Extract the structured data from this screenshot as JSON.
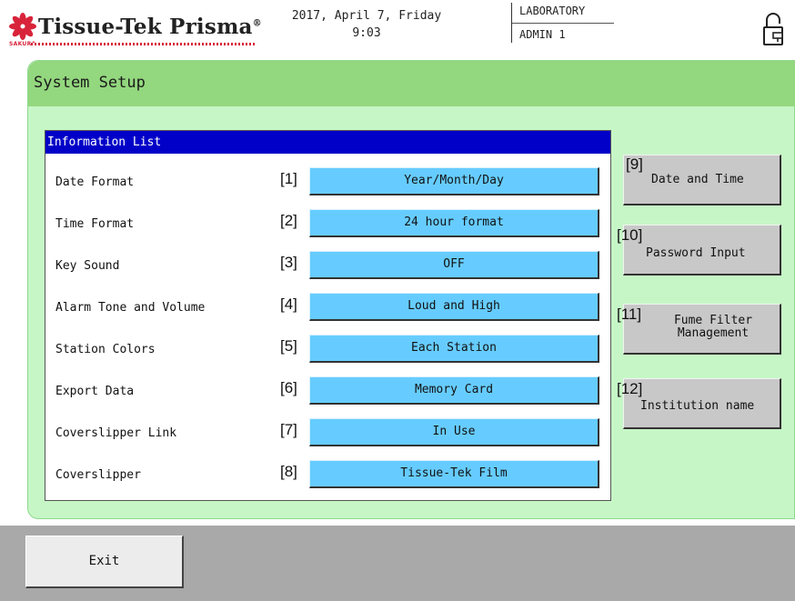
{
  "header": {
    "logo_text": "Tissue-Tek Prisma",
    "logo_reg": "®",
    "logo_brand": "SAKURA",
    "date": "2017, April 7, Friday",
    "time": "9:03",
    "area": "LABORATORY",
    "user": "ADMIN 1",
    "icons": {
      "logo": "sakura-flower-icon",
      "lock": "padlock-icon"
    },
    "colors": {
      "logo_red": "#d8243a"
    }
  },
  "panel": {
    "title": "System Setup",
    "colors": {
      "background": "#c6f6c6",
      "titlebar": "#93d77e"
    }
  },
  "info_list": {
    "title": "Information List",
    "colors": {
      "header": "#0000c8",
      "button": "#66ccff"
    },
    "rows": [
      {
        "label": "Date Format",
        "index": "[1]",
        "value": "Year/Month/Day"
      },
      {
        "label": "Time Format",
        "index": "[2]",
        "value": "24 hour format"
      },
      {
        "label": "Key Sound",
        "index": "[3]",
        "value": "OFF"
      },
      {
        "label": "Alarm Tone and Volume",
        "index": "[4]",
        "value": "Loud and High"
      },
      {
        "label": "Station Colors",
        "index": "[5]",
        "value": "Each Station"
      },
      {
        "label": "Export Data",
        "index": "[6]",
        "value": "Memory Card"
      },
      {
        "label": "Coverslipper Link",
        "index": "[7]",
        "value": "In Use"
      },
      {
        "label": "Coverslipper",
        "index": "[8]",
        "value": "Tissue-Tek Film"
      }
    ]
  },
  "side_buttons": [
    {
      "index": "[9]",
      "label_1": "Date and Time",
      "label_2": ""
    },
    {
      "index": "[10]",
      "label_1": "Password Input",
      "label_2": ""
    },
    {
      "index": "[11]",
      "label_1": "Fume Filter",
      "label_2": "Management"
    },
    {
      "index": "[12]",
      "label_1": "Institution name",
      "label_2": ""
    }
  ],
  "footer": {
    "exit_label": "Exit",
    "colors": {
      "background": "#a9a9a9"
    }
  }
}
